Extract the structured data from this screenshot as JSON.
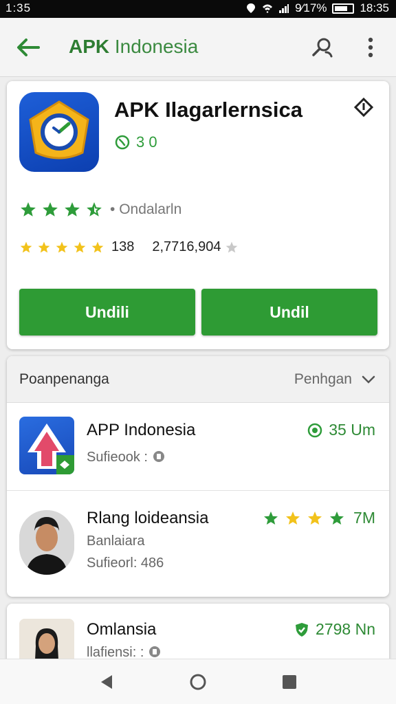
{
  "status_bar": {
    "time_left": "1:35",
    "battery_text": "9⁄17%",
    "time_right": "18:35"
  },
  "app_bar": {
    "title_bold": "APK",
    "title_rest": " Indonesia",
    "back_icon": "arrow-left-icon",
    "search_icon": "search-icon",
    "more_icon": "more-vert-icon"
  },
  "app_header": {
    "name": "APK Ilagarlernsica",
    "version": "3 0",
    "rating_label": "Ondalarln",
    "rating_count": "138",
    "downloads": "2,7716,904",
    "button_1": "Undili",
    "button_2": "Undil"
  },
  "list": {
    "header_left": "Poanpenanga",
    "header_right": "Penhgan",
    "items": [
      {
        "title": "APP Indonesia",
        "subtitle": "Sufieook :",
        "meta": "35 Um"
      },
      {
        "title": "Rlang loideansia",
        "subtitle_1": "Banlaiara",
        "subtitle_2": "Sufieorl: 486",
        "meta": "7M"
      },
      {
        "title": "Omlansia",
        "subtitle": "llafiensi: :",
        "meta": "2798 Nn"
      }
    ]
  },
  "colors": {
    "brand_green": "#2e9b34",
    "star_green": "#2e9c3a",
    "star_yellow": "#f2c21b",
    "icon_blue": "#1e5fd8"
  }
}
